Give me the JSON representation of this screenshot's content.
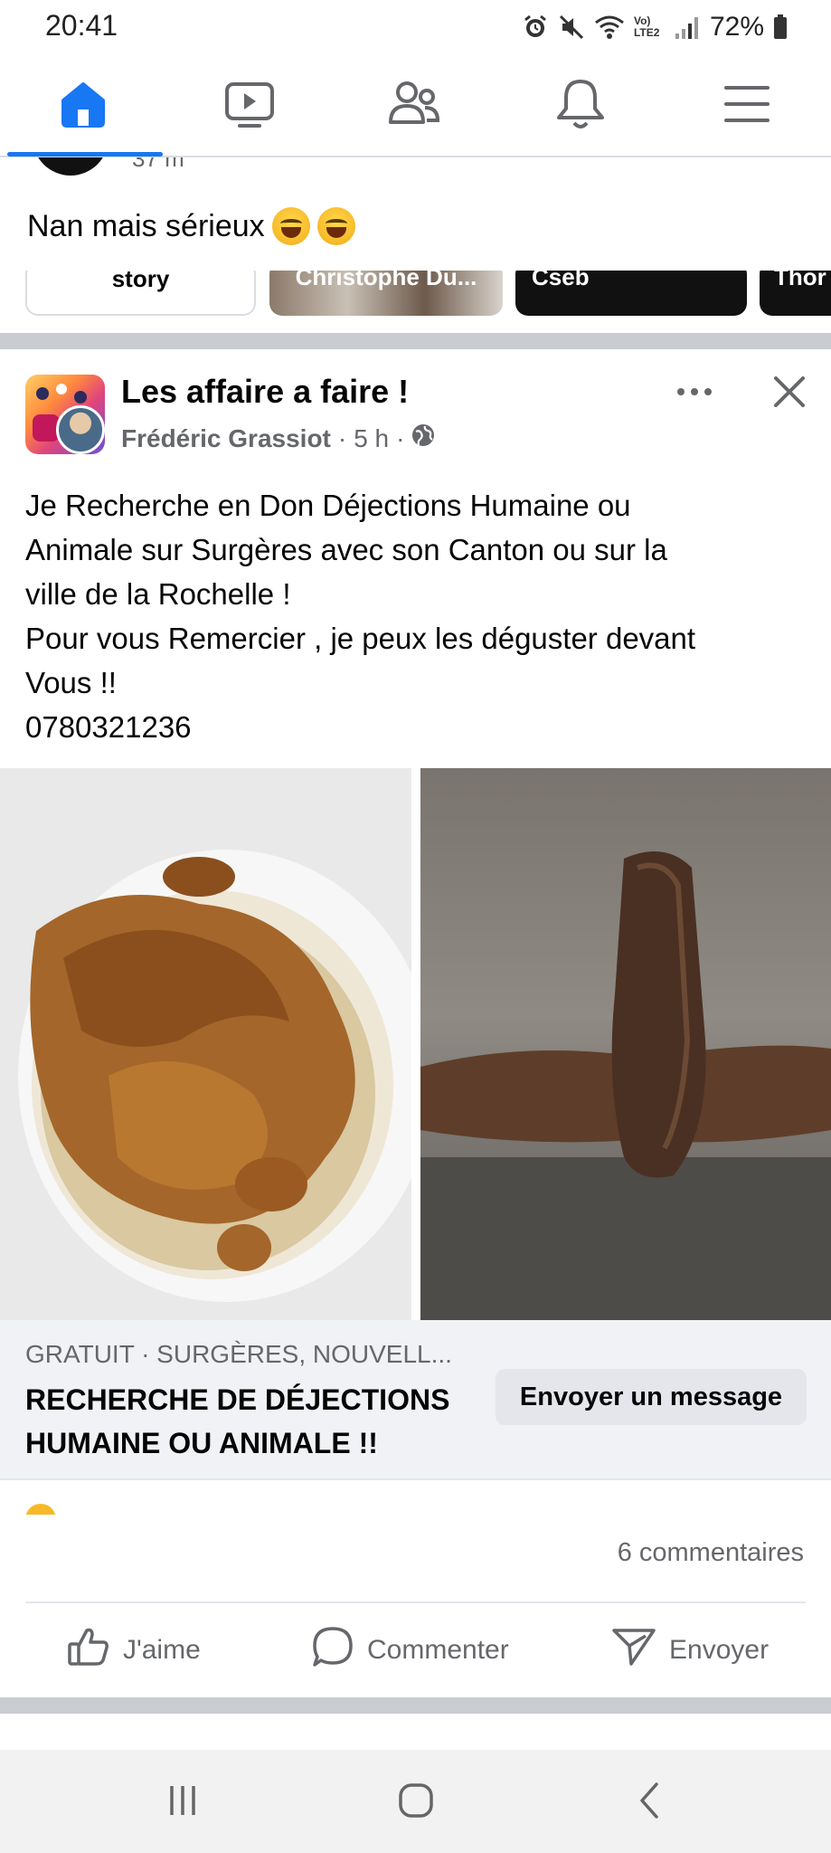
{
  "status_bar": {
    "time": "20:41",
    "battery": "72%",
    "network": "Vo) LTE2",
    "icons": [
      "alarm-icon",
      "mute-icon",
      "wifi-icon",
      "signal-icon",
      "battery-icon"
    ]
  },
  "nav": {
    "active": "home",
    "items": [
      "home-icon",
      "video-icon",
      "groups-icon",
      "notifications-icon",
      "menu-icon"
    ],
    "accent": "#1877f2"
  },
  "previous_post": {
    "meta": "37 m",
    "text": "Nan mais sérieux",
    "emojis": [
      "rolling-laughing-emoji",
      "laughing-tears-emoji"
    ],
    "stories": [
      "story",
      "Christophe Du...",
      "Cseb",
      "Thor"
    ]
  },
  "post": {
    "group_name": "Les affaire a faire !",
    "author": "Frédéric Grassiot",
    "time": "5 h",
    "privacy_icon": "globe-icon",
    "body_lines": [
      "Je Recherche en Don Déjections Humaine ou",
      "Animale sur Surgères avec son Canton ou sur la",
      "ville de la Rochelle !",
      "Pour vous Remercier , je peux les déguster devant",
      "Vous !!",
      "0780321236"
    ],
    "listing": {
      "subtitle": "GRATUIT · SURGÈRES, NOUVELL...",
      "title": "RECHERCHE DE DÉJECTIONS HUMAINE OU ANIMALE !!",
      "button": "Envoyer un message"
    },
    "comments": "6 commentaires",
    "actions": {
      "like": "J'aime",
      "comment": "Commenter",
      "send": "Envoyer"
    }
  },
  "colors": {
    "text_secondary": "#65676b",
    "separator": "#c9ccd1",
    "listing_bg": "#f0f2f5"
  }
}
